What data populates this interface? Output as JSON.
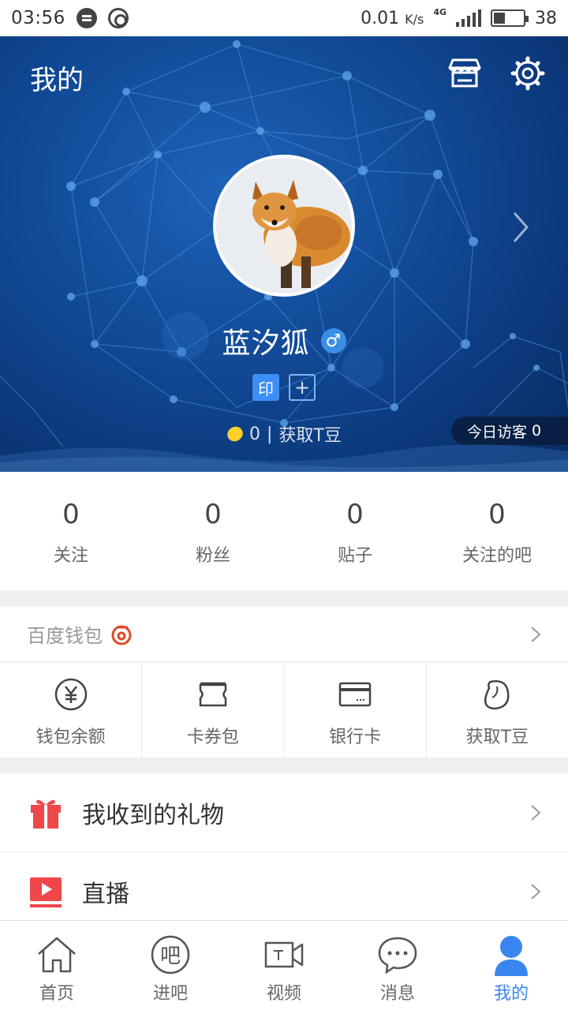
{
  "status_bar": {
    "time": "03:56",
    "speed": "0.01",
    "speed_unit": "K/s",
    "network": "4G",
    "battery": "38"
  },
  "header": {
    "title": "我的",
    "icons": [
      "store-icon",
      "gear-icon"
    ]
  },
  "profile": {
    "username": "蓝汐狐",
    "gender_symbol": "♂",
    "seal_badge": "印",
    "add_badge": "+",
    "tbean_count": "0",
    "tbean_separator": "|",
    "tbean_link": "获取T豆",
    "visitor_label": "今日访客",
    "visitor_count": "0"
  },
  "stats": [
    {
      "value": "0",
      "label": "关注"
    },
    {
      "value": "0",
      "label": "粉丝"
    },
    {
      "value": "0",
      "label": "贴子"
    },
    {
      "value": "0",
      "label": "关注的吧"
    }
  ],
  "wallet": {
    "title": "百度钱包",
    "items": [
      {
        "label": "钱包余额",
        "icon": "yen-icon"
      },
      {
        "label": "卡券包",
        "icon": "ticket-icon"
      },
      {
        "label": "银行卡",
        "icon": "bank-card-icon"
      },
      {
        "label": "获取T豆",
        "icon": "bean-icon"
      }
    ]
  },
  "menu": [
    {
      "label": "我收到的礼物",
      "icon": "gift-icon"
    },
    {
      "label": "直播",
      "icon": "live-play-icon"
    }
  ],
  "bottom_nav": [
    {
      "label": "首页",
      "icon": "home-icon"
    },
    {
      "label": "进吧",
      "icon": "bar-icon",
      "icon_text": "吧"
    },
    {
      "label": "视频",
      "icon": "video-icon"
    },
    {
      "label": "消息",
      "icon": "message-icon"
    },
    {
      "label": "我的",
      "icon": "profile-icon",
      "active": true
    }
  ],
  "colors": {
    "accent": "#3a86f0",
    "hero_dark": "#0c3a7e",
    "hero_light": "#1d63b8",
    "gift_red": "#f0474a"
  }
}
